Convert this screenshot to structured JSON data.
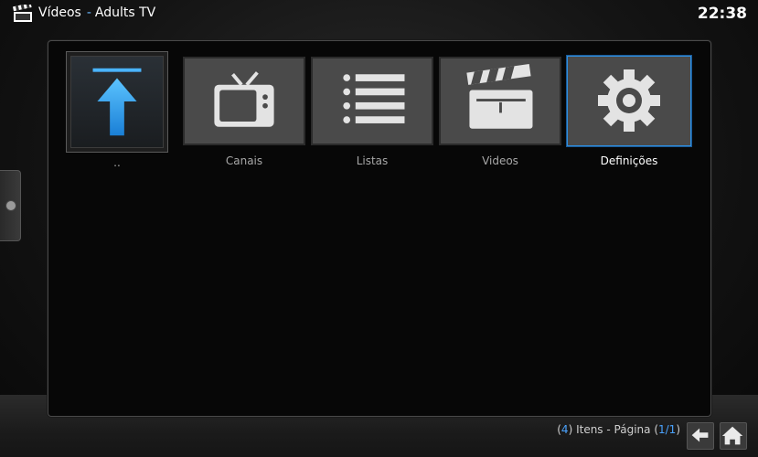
{
  "header": {
    "section": "Vídeos",
    "separator": "-",
    "addon": "Adults TV",
    "clock": "22:38"
  },
  "items": [
    {
      "label": "..",
      "icon": "up-arrow-icon"
    },
    {
      "label": "Canais",
      "icon": "tv-icon"
    },
    {
      "label": "Listas",
      "icon": "list-icon"
    },
    {
      "label": "Videos",
      "icon": "clapperboard-icon"
    },
    {
      "label": "Definições",
      "icon": "gear-icon"
    }
  ],
  "footer": {
    "count_open": "(",
    "count": "4",
    "count_close": ")",
    "items_text": "Itens - Página",
    "page_open": "(",
    "page": "1/1",
    "page_close": ")"
  },
  "colors": {
    "accent": "#2f8fe0",
    "tile": "#4a4a4a",
    "background": "#0d0d0d"
  }
}
